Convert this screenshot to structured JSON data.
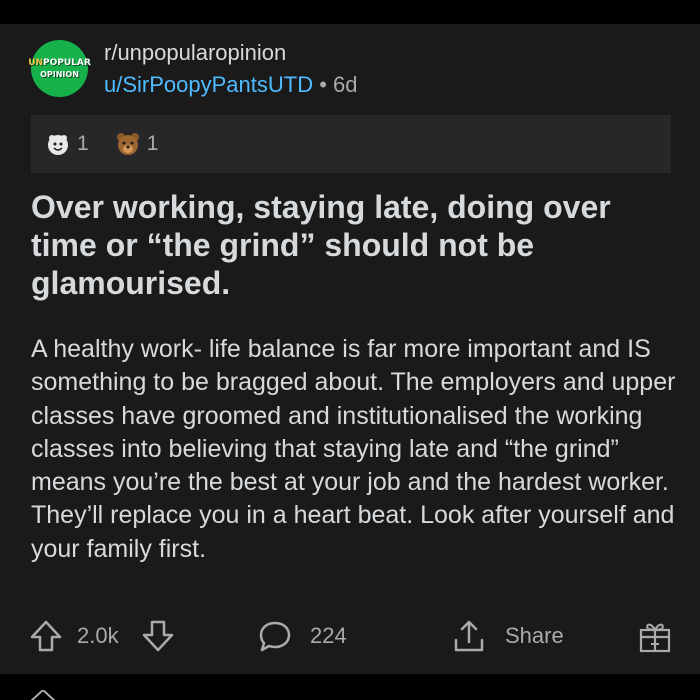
{
  "post": {
    "community": "r/unpopularopinion",
    "community_logo": {
      "line1_prefix": "UN",
      "line1_rest": "POPULAR",
      "line2": "OPINION"
    },
    "author": "u/SirPoopyPantsUTD",
    "separator": "•",
    "age": "6d",
    "awards": [
      {
        "icon": "wholesome-award-icon",
        "count": "1"
      },
      {
        "icon": "bear-award-icon",
        "count": "1"
      }
    ],
    "title": "Over working, staying late, doing over time or “the grind” should not be glamourised.",
    "body": "A healthy work- life balance is far more important and IS something to be bragged about. The employers and upper classes have groomed and institutionalised the working classes into believing that staying late and “the grind” means you’re the best at your job and the hardest worker. They’ll replace you in a heart beat. Look after yourself and your family first."
  },
  "actions": {
    "score": "2.0k",
    "comments": "224",
    "share_label": "Share",
    "icons": [
      "upvote-icon",
      "downvote-icon",
      "comment-icon",
      "share-icon",
      "gift-icon"
    ]
  },
  "colors": {
    "background": "#000000",
    "card": "#1a1a1b",
    "award_bar": "#272729",
    "text": "#d7dadc",
    "muted": "#a8aaab",
    "author_link": "#4fbcff",
    "logo_green": "#16b14b"
  }
}
